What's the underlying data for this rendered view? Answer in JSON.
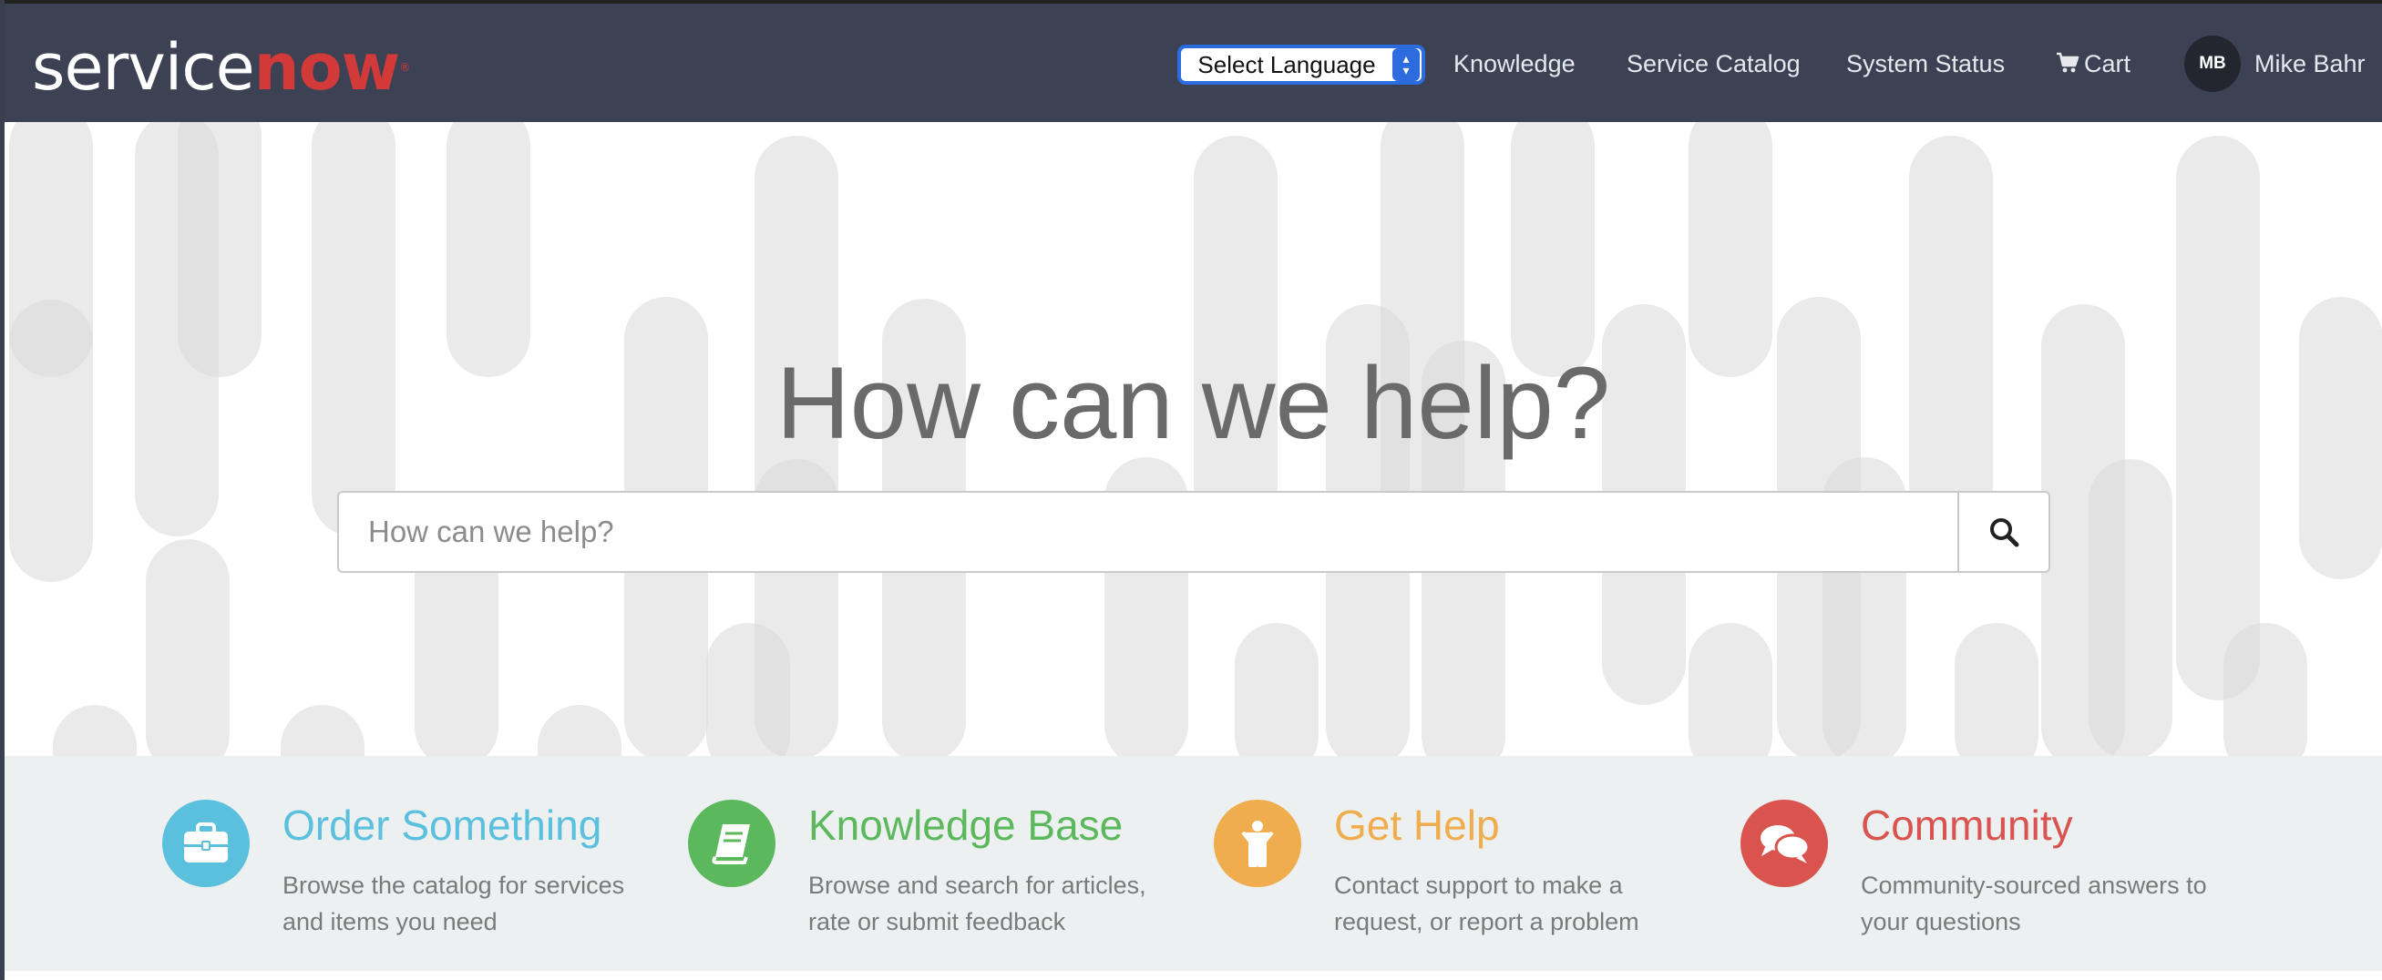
{
  "header": {
    "logo_text_white": "service",
    "logo_text_red": "now",
    "logo_mark": "®",
    "language_select": "Select Language",
    "nav": [
      "Knowledge",
      "Service Catalog",
      "System Status",
      "Cart"
    ],
    "avatar_initials": "MB",
    "user_name": "Mike Bahr"
  },
  "hero": {
    "title": "How can we help?",
    "search_placeholder": "How can we help?"
  },
  "features": [
    {
      "title": "Order Something",
      "line1": "Browse the catalog for services",
      "line2": "and items you need",
      "color": "#5bc0de",
      "icon": "briefcase-icon"
    },
    {
      "title": "Knowledge Base",
      "line1": "Browse and search for articles,",
      "line2": "rate or submit feedback",
      "color": "#5cb85c",
      "icon": "book-icon"
    },
    {
      "title": "Get Help",
      "line1": "Contact support to make a",
      "line2": "request, or report a problem",
      "color": "#f0ad4e",
      "icon": "person-icon"
    },
    {
      "title": "Community",
      "line1": "Community-sourced answers to",
      "line2": "your questions",
      "color": "#d9534f",
      "icon": "comments-icon"
    }
  ]
}
